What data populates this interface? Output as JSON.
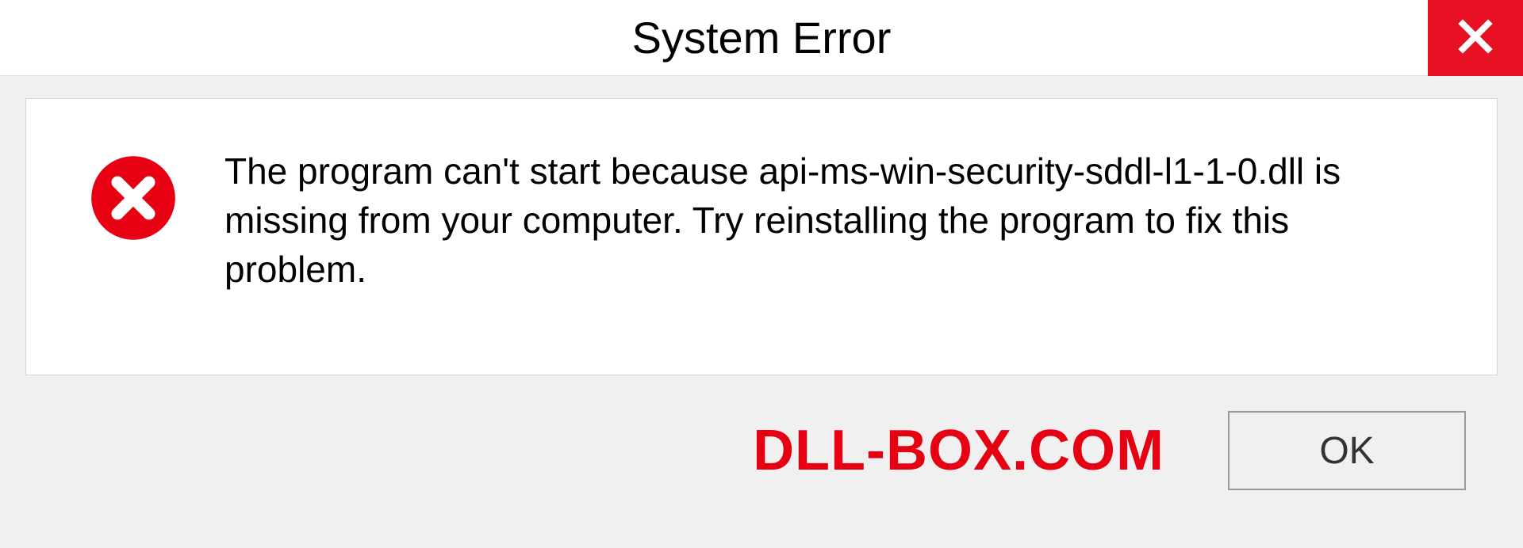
{
  "dialog": {
    "title": "System Error",
    "message": "The program can't start because api-ms-win-security-sddl-l1-1-0.dll is missing from your computer. Try reinstalling the program to fix this problem.",
    "ok_label": "OK"
  },
  "watermark": "DLL-BOX.COM",
  "colors": {
    "close_bg": "#e81123",
    "error_red": "#e60012",
    "watermark_red": "#e60012"
  }
}
